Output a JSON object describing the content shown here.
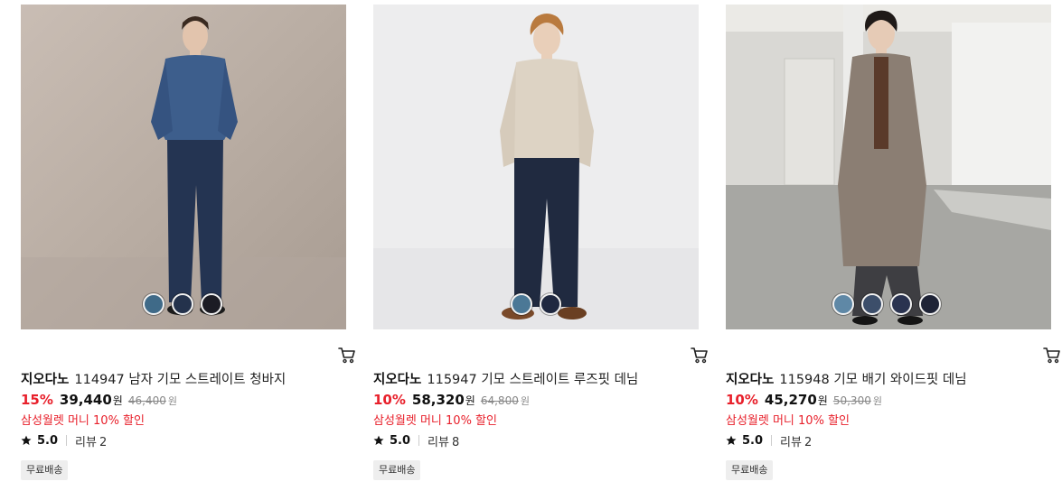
{
  "products": [
    {
      "brand": "지오다노",
      "name": "114947 남자 기모 스트레이트 청바지",
      "discount": "15%",
      "price": "39,440",
      "currency": "원",
      "original_price": "46,400",
      "promo": "삼성월렛 머니 10% 할인",
      "rating": "5.0",
      "review_label": "리뷰",
      "review_count": "2",
      "badge": "무료배송",
      "swatch_colors": [
        "#3f6a88",
        "#24324c",
        "#1c1c24"
      ]
    },
    {
      "brand": "지오다노",
      "name": "115947 기모 스트레이트 루즈핏 데님",
      "discount": "10%",
      "price": "58,320",
      "currency": "원",
      "original_price": "64,800",
      "promo": "삼성월렛 머니 10% 할인",
      "rating": "5.0",
      "review_label": "리뷰",
      "review_count": "8",
      "badge": "무료배송",
      "swatch_colors": [
        "#4b7896",
        "#1f2840"
      ]
    },
    {
      "brand": "지오다노",
      "name": "115948 기모 배기 와이드핏 데님",
      "discount": "10%",
      "price": "45,270",
      "currency": "원",
      "original_price": "50,300",
      "promo": "삼성월렛 머니 10% 할인",
      "rating": "5.0",
      "review_label": "리뷰",
      "review_count": "2",
      "badge": "무료배송",
      "swatch_colors": [
        "#5f88a6",
        "#3c4e6a",
        "#2a3350",
        "#1e2336"
      ]
    }
  ],
  "colors": {
    "discount_red": "#e8202b",
    "badge_bg": "#eeeeee"
  }
}
